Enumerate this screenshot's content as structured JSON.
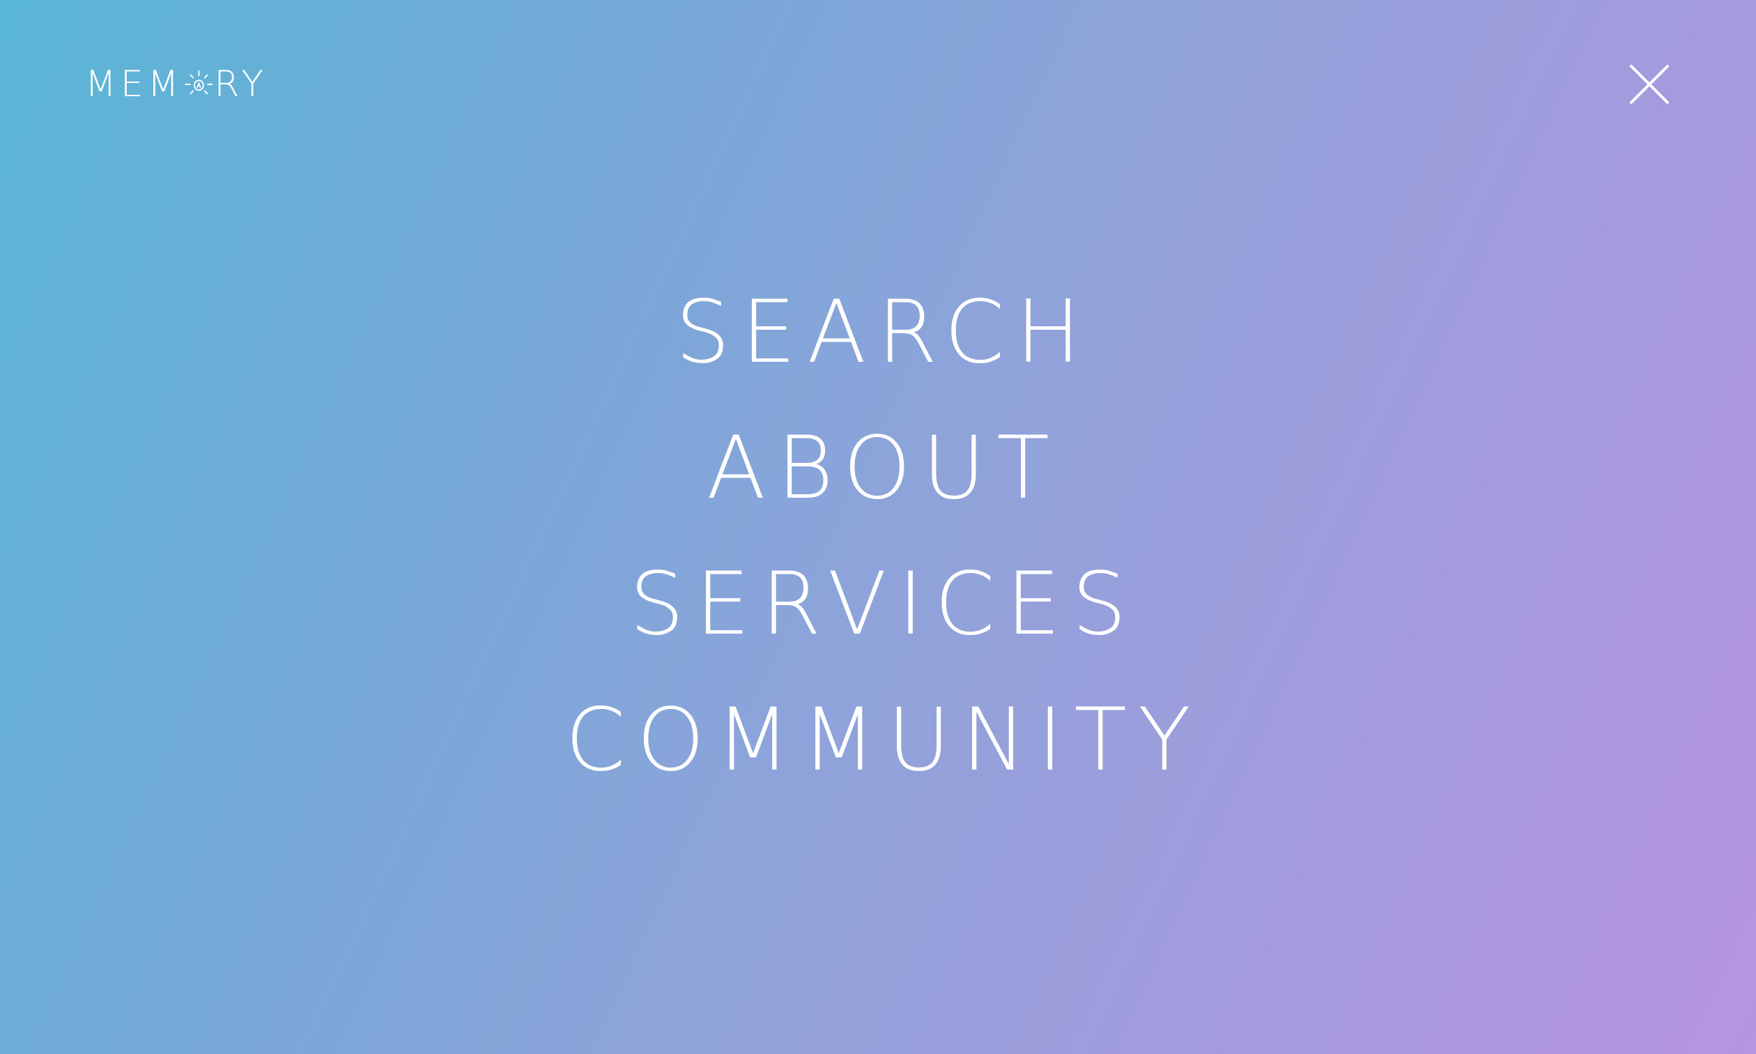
{
  "brand": {
    "name": "MEMORY",
    "logo_left": "MEM",
    "logo_right": "RY",
    "logo_icon": "lightbulb-o-icon"
  },
  "header": {
    "close_icon": "close-icon"
  },
  "menu": {
    "items": [
      {
        "label": "SEARCH"
      },
      {
        "label": "ABOUT"
      },
      {
        "label": "SERVICES"
      },
      {
        "label": "COMMUNITY"
      }
    ]
  },
  "colors": {
    "gradient_start": "#59b6d6",
    "gradient_end": "#b795e0",
    "text": "#ffffff"
  }
}
